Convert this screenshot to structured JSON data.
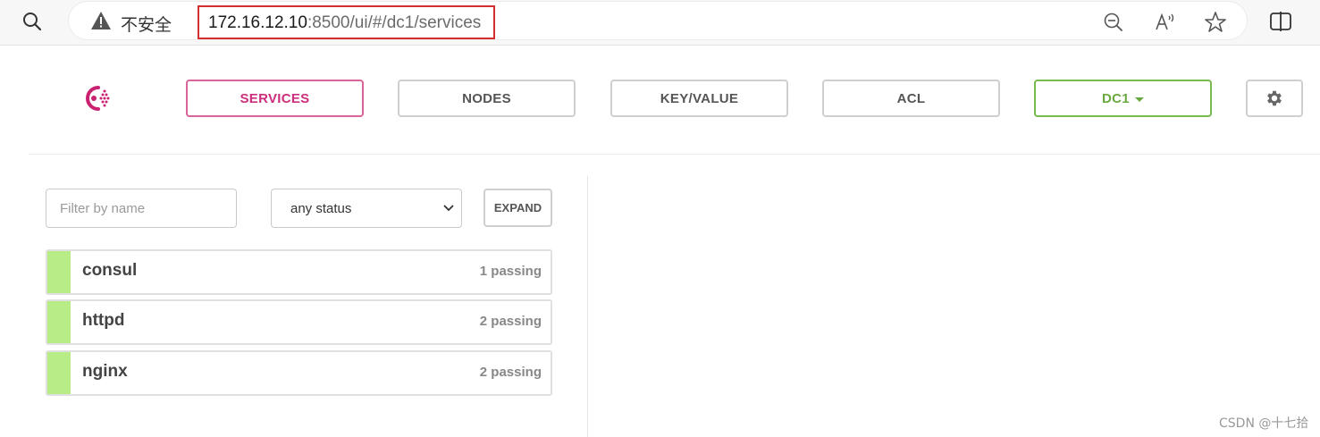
{
  "browser": {
    "insecure_label": "不安全",
    "url_host": "172.16.12.10",
    "url_rest": ":8500/ui/#/dc1/services"
  },
  "nav": {
    "services": "SERVICES",
    "nodes": "NODES",
    "key_value": "KEY/VALUE",
    "acl": "ACL",
    "datacenter": "DC1"
  },
  "filters": {
    "name_placeholder": "Filter by name",
    "status_value": "any status",
    "expand_label": "EXPAND"
  },
  "services": [
    {
      "name": "consul",
      "status": "1 passing"
    },
    {
      "name": "httpd",
      "status": "2 passing"
    },
    {
      "name": "nginx",
      "status": "2 passing"
    }
  ],
  "watermark": "CSDN @十七拾",
  "colors": {
    "accent": "#cc2d7c",
    "datacenter": "#6aa83f",
    "passing": "#b8ec86"
  }
}
